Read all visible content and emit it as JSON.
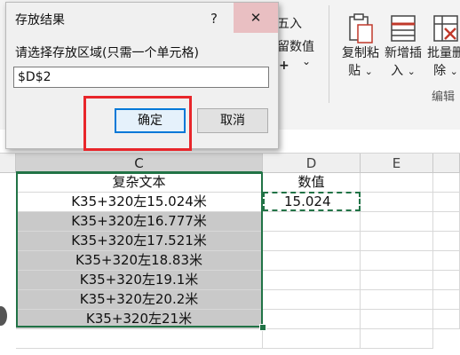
{
  "ribbon": {
    "partial_label_1": "五入",
    "partial_label_2": "留数值",
    "partial_plus": "+",
    "copy_paste": {
      "line1": "复制粘",
      "line2": "贴"
    },
    "insert_new": {
      "line1": "新增插",
      "line2": "入"
    },
    "batch_delete": {
      "line1": "批量删",
      "line2": "除"
    },
    "group_name": "编辑",
    "chevron": "⌄"
  },
  "dialog": {
    "title": "存放结果",
    "help": "?",
    "close": "✕",
    "prompt": "请选择存放区域(只需一个单元格)",
    "input_value": "$D$2",
    "ok_label": "确定",
    "cancel_label": "取消"
  },
  "sheet": {
    "columns": [
      "C",
      "D",
      "E"
    ],
    "header_row": {
      "c": "复杂文本",
      "d": "数值"
    },
    "rows": [
      {
        "c": "K35+320左15.024米",
        "d": "15.024"
      },
      {
        "c": "K35+320左16.777米",
        "d": ""
      },
      {
        "c": "K35+320左17.521米",
        "d": ""
      },
      {
        "c": "K35+320左18.83米",
        "d": ""
      },
      {
        "c": "K35+320左19.1米",
        "d": ""
      },
      {
        "c": "K35+320左20.2米",
        "d": ""
      },
      {
        "c": "K35+320左21米",
        "d": ""
      }
    ]
  }
}
